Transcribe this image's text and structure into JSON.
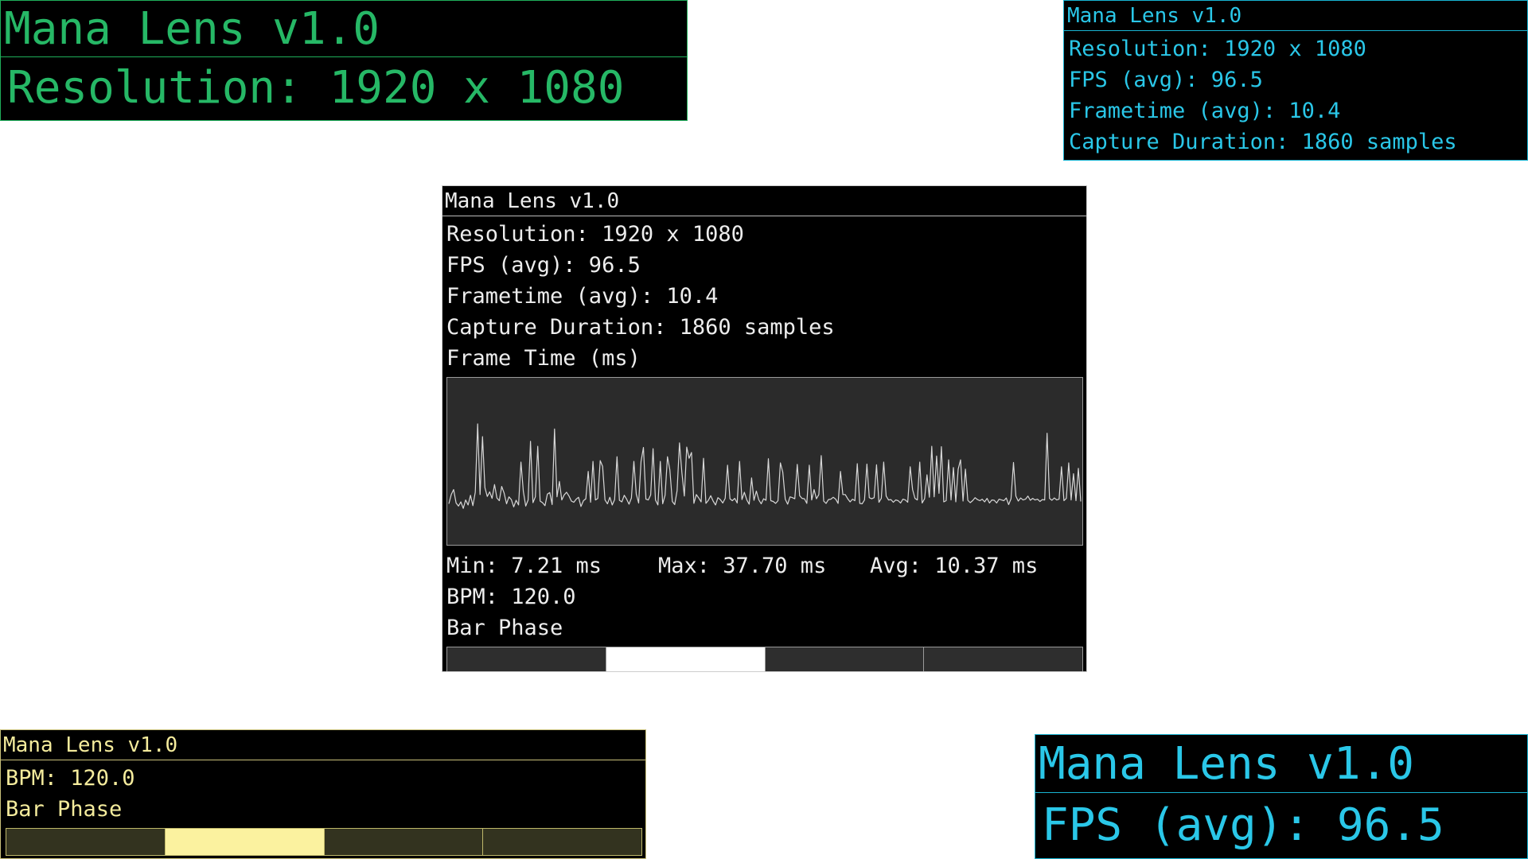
{
  "app": {
    "title": "Mana Lens v1.0"
  },
  "metrics": {
    "resolution": "Resolution: 1920 x 1080",
    "fps": "FPS (avg): 96.5",
    "frametime": "Frametime (avg): 10.4",
    "capture": "Capture Duration: 1860 samples",
    "bpm": "BPM: 120.0",
    "bar_phase_label": "Bar Phase"
  },
  "frame_graph": {
    "title": "Frame Time (ms)",
    "min_text": "Min: 7.21 ms",
    "max_text": "Max: 37.70 ms",
    "avg_text": "Avg: 10.37 ms",
    "line_color": "#d8d8d8",
    "background": "#2b2b2b"
  },
  "bar_phase": {
    "segments": 4,
    "active_index": 1
  },
  "themes": {
    "green": "#26b866",
    "cyan": "#2ac7e8",
    "white": "#ededed",
    "yellow": "#f4eb9c"
  },
  "chart_data": {
    "type": "line",
    "title": "Frame Time (ms)",
    "xlabel": "",
    "ylabel": "",
    "ylim": [
      0,
      40
    ],
    "grid": false,
    "series": [
      {
        "values": [
          9.4,
          11.8,
          13.1,
          9.6,
          8.8,
          9.9,
          8.2,
          10.4,
          9.1,
          11.6,
          8.9,
          12.4,
          30.1,
          11.8,
          26.8,
          13.6,
          11.3,
          12.5,
          10.8,
          14.4,
          10.9,
          10.2,
          13.9,
          12.2,
          9.4,
          11.2,
          10.5,
          8.6,
          10.3,
          9.1,
          20.2,
          12.6,
          8.8,
          10.4,
          25.6,
          9.7,
          11.2,
          24.3,
          10.1,
          9.7,
          8.9,
          11.9,
          12.3,
          9.2,
          28.8,
          11.2,
          15.2,
          10.4,
          11.7,
          12.4,
          11.4,
          10.1,
          9.8,
          10.6,
          11.1,
          8.7,
          10.2,
          10.7,
          17.8,
          9.8,
          20.4,
          10.4,
          10.8,
          20.6,
          19.1,
          10.4,
          9.4,
          11.1,
          9.1,
          10.5,
          21.6,
          10.3,
          9.9,
          11.6,
          10.6,
          9.3,
          10.9,
          20.4,
          11.9,
          9.6,
          20.4,
          24.0,
          10.6,
          10.4,
          11.7,
          23.7,
          10.4,
          9.1,
          20.4,
          9.4,
          11.6,
          21.6,
          18.2,
          10.0,
          9.2,
          12.8,
          25.2,
          17.5,
          11.4,
          24.1,
          21.2,
          22.7,
          9.5,
          11.8,
          10.9,
          9.9,
          21.2,
          9.5,
          10.3,
          11.5,
          10.1,
          9.1,
          11.0,
          10.5,
          9.6,
          10.8,
          19.4,
          10.7,
          10.2,
          10.8,
          9.6,
          20.4,
          10.5,
          12.4,
          10.4,
          9.3,
          16.1,
          10.3,
          12.7,
          10.4,
          9.4,
          10.7,
          10.3,
          21.1,
          10.2,
          10.0,
          9.5,
          10.2,
          20.0,
          17.6,
          10.6,
          9.3,
          11.2,
          11.0,
          10.7,
          19.6,
          11.5,
          10.8,
          10.7,
          9.5,
          19.4,
          10.4,
          13.1,
          10.7,
          11.8,
          21.9,
          10.1,
          9.5,
          10.5,
          10.6,
          11.1,
          10.6,
          9.5,
          17.8,
          11.8,
          11.8,
          10.7,
          9.9,
          10.6,
          10.2,
          19.8,
          9.5,
          9.4,
          10.4,
          19.7,
          11.0,
          10.7,
          11.0,
          19.5,
          9.8,
          10.8,
          20.2,
          11.4,
          10.4,
          10.5,
          9.8,
          10.4,
          10.2,
          9.6,
          10.6,
          10.4,
          9.8,
          19.0,
          13.1,
          10.8,
          10.4,
          20.2,
          9.6,
          10.7,
          16.9,
          11.1,
          24.3,
          11.2,
          21.8,
          12.1,
          24.2,
          9.9,
          10.2,
          20.8,
          10.4,
          18.8,
          9.9,
          18.4,
          20.8,
          10.1,
          18.4,
          10.3,
          9.7,
          10.2,
          11.0,
          10.5,
          10.2,
          10.6,
          9.9,
          10.8,
          9.6,
          10.4,
          10.3,
          9.6,
          10.6,
          10.4,
          10.2,
          10.9,
          9.2,
          10.7,
          20.1,
          11.4,
          10.1,
          10.9,
          10.4,
          10.6,
          11.4,
          10.3,
          10.8,
          10.4,
          10.6,
          10.0,
          10.5,
          10.4,
          27.7,
          10.8,
          10.3,
          10.9,
          10.4,
          10.6,
          19.0,
          10.2,
          10.8,
          20.0,
          10.4,
          17.2,
          10.2,
          18.6,
          10.0
        ]
      }
    ]
  }
}
